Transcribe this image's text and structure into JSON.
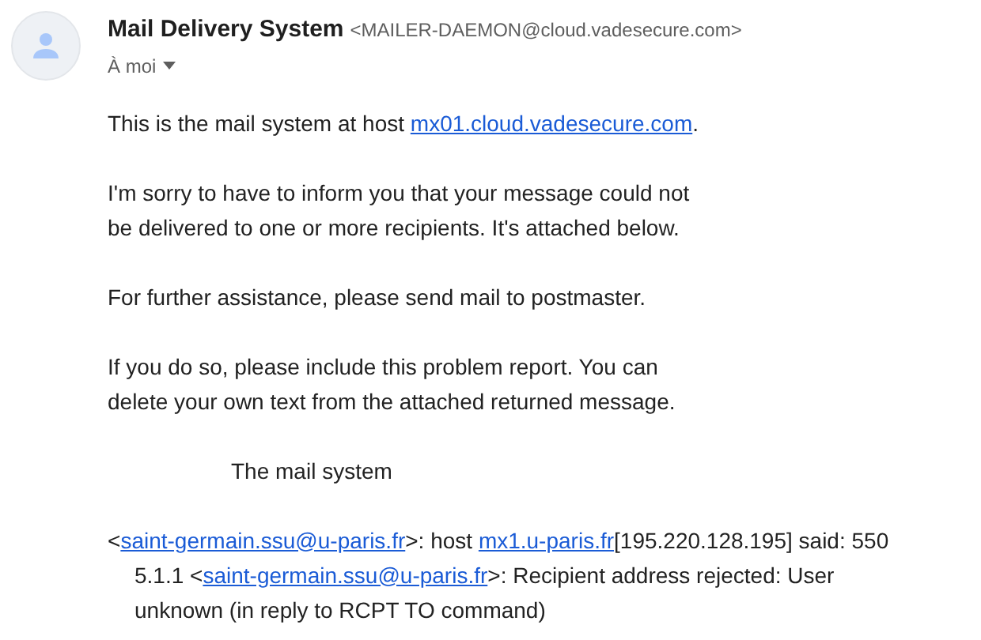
{
  "sender": {
    "name": "Mail Delivery System",
    "address": "<MAILER-DAEMON@cloud.vadesecure.com>",
    "recipient": "À moi"
  },
  "body": [
    {
      "kind": "plain",
      "lines": [
        [
          {
            "kind": "text",
            "text": "This is the mail system at host "
          },
          {
            "kind": "link",
            "text": "mx01.cloud.vadesecure.com"
          },
          {
            "kind": "text",
            "text": "."
          }
        ]
      ]
    },
    {
      "kind": "plain",
      "lines": [
        [
          {
            "kind": "text",
            "text": "I'm sorry to have to inform you that your message could not"
          }
        ],
        [
          {
            "kind": "text",
            "text": "be delivered to one or more recipients. It's attached below."
          }
        ]
      ]
    },
    {
      "kind": "plain",
      "lines": [
        [
          {
            "kind": "text",
            "text": "For further assistance, please send mail to postmaster."
          }
        ]
      ]
    },
    {
      "kind": "plain",
      "lines": [
        [
          {
            "kind": "text",
            "text": "If you do so, please include this problem report. You can"
          }
        ],
        [
          {
            "kind": "text",
            "text": "delete your own text from the attached returned message."
          }
        ]
      ]
    },
    {
      "kind": "signature",
      "lines": [
        [
          {
            "kind": "text",
            "text": "The mail system"
          }
        ]
      ]
    },
    {
      "kind": "hanging",
      "lines": [
        [
          {
            "kind": "text",
            "text": "<"
          },
          {
            "kind": "link",
            "text": "saint-germain.ssu@u-paris.fr"
          },
          {
            "kind": "text",
            "text": ">: host "
          },
          {
            "kind": "link",
            "text": "mx1.u-paris.fr"
          },
          {
            "kind": "text",
            "text": "[195.220.128.195] said: 550"
          }
        ],
        [
          {
            "kind": "text",
            "text": "5.1.1 <"
          },
          {
            "kind": "link",
            "text": "saint-germain.ssu@u-paris.fr"
          },
          {
            "kind": "text",
            "text": ">: Recipient address rejected: User"
          }
        ],
        [
          {
            "kind": "text",
            "text": "unknown (in reply to RCPT TO command)"
          }
        ]
      ]
    }
  ]
}
